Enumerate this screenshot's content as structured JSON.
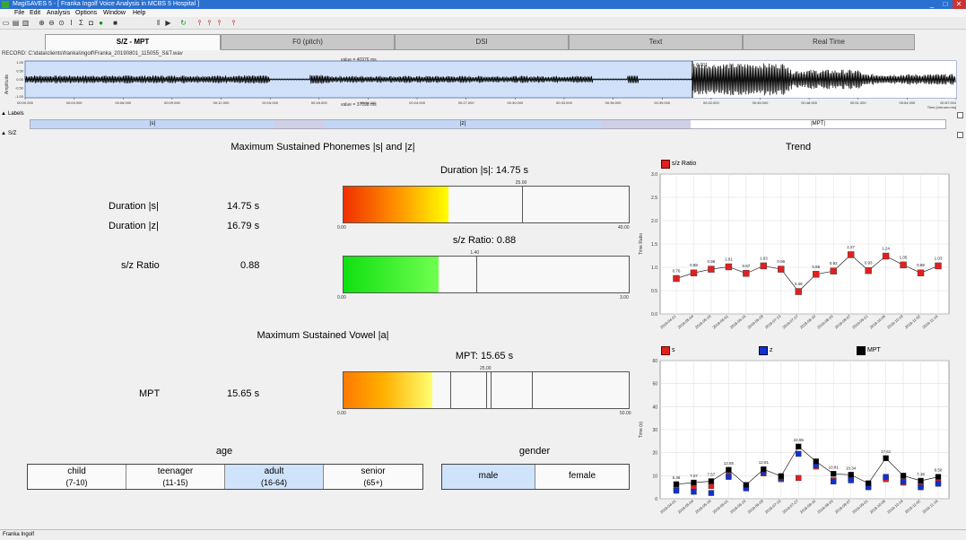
{
  "window": {
    "title": "MagiSAVES 5 - [ Franka Ingolf Voice Analysis in MCBS 5 Hospital ]",
    "minimize": "_",
    "maximize": "□",
    "close": "✕"
  },
  "menu": [
    "File",
    "Edit",
    "Analysis",
    "Options",
    "Window",
    "Help"
  ],
  "tabs": [
    {
      "label": "S/Z - MPT",
      "active": true
    },
    {
      "label": "F0 (pitch)",
      "active": false
    },
    {
      "label": "DSI",
      "active": false
    },
    {
      "label": "Text",
      "active": false
    },
    {
      "label": "Real Time",
      "active": false
    }
  ],
  "waveform": {
    "record_path": "RECORD: C:\\data\\clients\\franka\\ingolf\\Franka_20190801_115055_S&T.wav",
    "amplitude_label": "Amplitude",
    "value_top": "value = 40976 ms",
    "value_bottom": "value = 37098 ms",
    "cursor_label": "+ 0.001",
    "y_ticks": [
      "1.00",
      "0.50",
      "0.00",
      "-0.50",
      "-1.00"
    ],
    "x_ticks": [
      "00:00.000",
      "00:03.000",
      "00:06.000",
      "00:09.000",
      "00:12.000",
      "00:15.000",
      "00:18.000",
      "00:21.000",
      "00:24.000",
      "00:27.000",
      "00:30.000",
      "00:33.000",
      "00:36.000",
      "00:39.000",
      "00:42.000",
      "00:45.000",
      "00:48.000",
      "00:51.000",
      "00:54.000",
      "00:57.004"
    ],
    "x_axis_label": "Time [min:sec:ms]"
  },
  "labels_panel": {
    "title": "Labels",
    "segments": [
      "|s|",
      "|z|",
      "|MPT|"
    ]
  },
  "sz_panel": {
    "title": "S/Z"
  },
  "phonemes": {
    "heading": "Maximum Sustained Phonemes |s| and |z|",
    "duration_s_label": "Duration |s|",
    "duration_s_value": "14.75 s",
    "duration_z_label": "Duration |z|",
    "duration_z_value": "16.79 s",
    "sz_label": "s/z Ratio",
    "sz_value": "0.88",
    "bar1_title": "Duration |s|: 14.75 s",
    "bar1_fraction": 0.3688,
    "bar1_marker": "25.00",
    "bar1_min": "0.00",
    "bar1_max": "40.00",
    "bar2_title": "s/z Ratio: 0.88",
    "bar2_fraction": 0.3333,
    "bar2_marker": "1.40",
    "bar2_min": "0.00",
    "bar2_max": "3.00"
  },
  "vowel": {
    "heading": "Maximum Sustained Vowel |a|",
    "mpt_label": "MPT",
    "mpt_value": "15.65 s",
    "bar_title": "MPT: 15.65 s",
    "bar_fraction": 0.3125,
    "bar_marker": "25.00",
    "bar_min": "0.00",
    "bar_max": "50.00"
  },
  "age": {
    "heading": "age",
    "options": [
      {
        "label": "child",
        "range": "(7-10)",
        "selected": false
      },
      {
        "label": "teenager",
        "range": "(11-15)",
        "selected": false
      },
      {
        "label": "adult",
        "range": "(16-64)",
        "selected": true
      },
      {
        "label": "senior",
        "range": "(65+)",
        "selected": false
      }
    ]
  },
  "gender": {
    "heading": "gender",
    "options": [
      {
        "label": "male",
        "selected": true
      },
      {
        "label": "female",
        "selected": false
      }
    ]
  },
  "trend": {
    "heading": "Trend"
  },
  "chart_data": [
    {
      "type": "line",
      "title": "",
      "ylabel": "Time Ratio",
      "ylim": [
        0,
        3
      ],
      "yticks": [
        "0.0",
        "0.5",
        "1.0",
        "1.5",
        "2.0",
        "2.5",
        "3.0"
      ],
      "series": [
        {
          "name": "s/z Ratio",
          "color": "#e02020",
          "values": [
            0.76,
            0.88,
            0.96,
            1.01,
            0.87,
            1.03,
            0.96,
            0.48,
            0.85,
            0.92,
            1.27,
            0.93,
            1.24,
            1.05,
            0.88,
            1.03
          ],
          "labels": [
            "0.76",
            "0.88",
            "0.96",
            "1.01",
            "0.87",
            "1.03",
            "0.96",
            "0.48",
            "0.85",
            "0.92",
            "1.27",
            "0.93",
            "1.24",
            "1.05",
            "0.88",
            "1.03"
          ]
        }
      ],
      "grid": true
    },
    {
      "type": "line",
      "title": "",
      "ylabel": "Time (s)",
      "ylim": [
        0,
        60
      ],
      "yticks": [
        "0",
        "10",
        "20",
        "30",
        "40",
        "50",
        "60"
      ],
      "series": [
        {
          "name": "s",
          "color": "#e02020",
          "values": [
            4.5,
            5.0,
            5.5,
            10.0,
            5.0,
            11.0,
            8.5,
            9.0,
            14.0,
            8.0,
            9.0,
            5.5,
            8.5,
            7.0,
            6.0,
            7.0
          ]
        },
        {
          "name": "z",
          "color": "#1030d0",
          "values": [
            3.5,
            3.0,
            2.5,
            9.5,
            4.5,
            11.5,
            9.0,
            19.5,
            14.5,
            7.5,
            8.0,
            5.0,
            9.5,
            7.5,
            5.0,
            6.5
          ]
        },
        {
          "name": "MPT",
          "color": "#000000",
          "values": [
            6.3,
            7.0,
            7.6,
            12.55,
            6.0,
            12.8,
            9.8,
            22.65,
            16.2,
            10.81,
            10.4,
            6.7,
            17.6,
            10.0,
            7.8,
            9.5
          ]
        }
      ],
      "point_labels": [
        "6.36",
        "7.07",
        "7.57",
        "12.55",
        "",
        "12.81",
        "",
        "22.65",
        "",
        "10.81",
        "10.34",
        "",
        "17.61",
        "",
        "7.18",
        "9.50"
      ],
      "grid": true
    }
  ]
}
